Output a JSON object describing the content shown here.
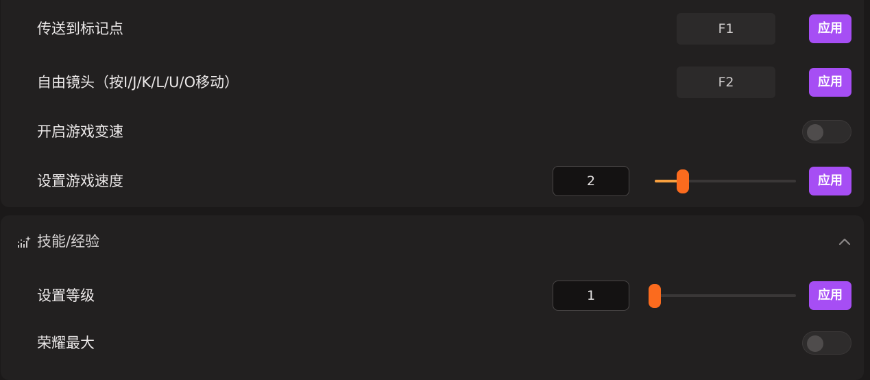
{
  "top_section": {
    "rows": [
      {
        "label": "传送到标记点",
        "hotkey": "F1",
        "apply": "应用"
      },
      {
        "label": "自由镜头（按I/J/K/L/U/O移动）",
        "hotkey": "F2",
        "apply": "应用"
      },
      {
        "label": "开启游戏变速",
        "toggle_on": false
      },
      {
        "label": "设置游戏速度",
        "value": "2",
        "slider_fraction": 0.2,
        "apply": "应用"
      }
    ]
  },
  "skills_section": {
    "title": "技能/经验",
    "icon": "bar-chart-sparkle-icon",
    "expanded": true,
    "rows": [
      {
        "label": "设置等级",
        "value": "1",
        "slider_fraction": 0.0,
        "apply": "应用"
      },
      {
        "label": "荣耀最大",
        "toggle_on": false
      }
    ]
  },
  "colors": {
    "accent_purple": "#a64ef4",
    "slider_thumb": "#fb6b1e",
    "slider_fill": "#f9a03f",
    "background": "#1b1919",
    "card": "#222020"
  }
}
